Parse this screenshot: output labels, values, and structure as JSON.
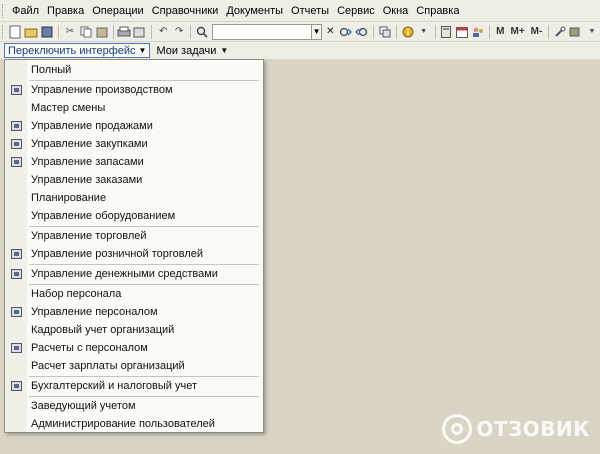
{
  "menubar": {
    "items": [
      {
        "label": "Файл"
      },
      {
        "label": "Правка"
      },
      {
        "label": "Операции"
      },
      {
        "label": "Справочники"
      },
      {
        "label": "Документы"
      },
      {
        "label": "Отчеты"
      },
      {
        "label": "Сервис"
      },
      {
        "label": "Окна"
      },
      {
        "label": "Справка"
      }
    ]
  },
  "toolbar": {
    "search_value": "",
    "memory_buttons": {
      "m": "M",
      "m_plus": "M+",
      "m_minus": "M-"
    }
  },
  "panel": {
    "switch_label": "Переключить интерфейс",
    "tasks_label": "Мои задачи"
  },
  "dropdown": {
    "items": [
      {
        "label": "Полный",
        "icon": "none"
      },
      {
        "label": "Управление производством",
        "icon": "production-icon"
      },
      {
        "label": "Мастер смены",
        "icon": "none"
      },
      {
        "label": "Управление продажами",
        "icon": "sales-icon"
      },
      {
        "label": "Управление закупками",
        "icon": "purchases-icon"
      },
      {
        "label": "Управление запасами",
        "icon": "stock-icon"
      },
      {
        "label": "Управление заказами",
        "icon": "none"
      },
      {
        "label": "Планирование",
        "icon": "none"
      },
      {
        "label": "Управление оборудованием",
        "icon": "none"
      },
      {
        "label": "Управление торговлей",
        "icon": "none"
      },
      {
        "label": "Управление розничной торговлей",
        "icon": "retail-icon"
      },
      {
        "label": "Управление денежными средствами",
        "icon": "money-icon"
      },
      {
        "label": "Набор персонала",
        "icon": "none"
      },
      {
        "label": "Управление персоналом",
        "icon": "personnel-icon"
      },
      {
        "label": "Кадровый учет организаций",
        "icon": "none"
      },
      {
        "label": "Расчеты с персоналом",
        "icon": "payroll-icon"
      },
      {
        "label": "Расчет зарплаты организаций",
        "icon": "none"
      },
      {
        "label": "Бухгалтерский и налоговый учет",
        "icon": "accounting-icon"
      },
      {
        "label": "Заведующий учетом",
        "icon": "none"
      },
      {
        "label": "Администрирование пользователей",
        "icon": "none"
      }
    ]
  },
  "watermark": {
    "text": "ОТЗОВИК"
  }
}
